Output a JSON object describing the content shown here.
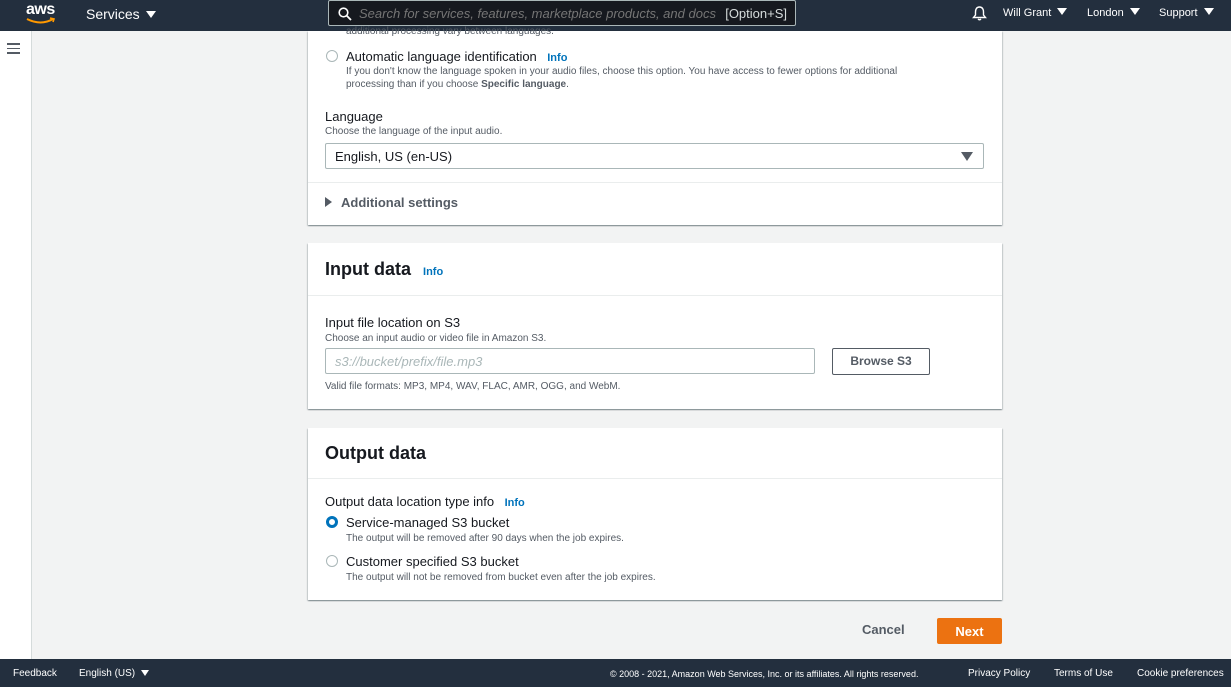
{
  "topnav": {
    "logo": "aws",
    "services": "Services",
    "search_placeholder": "Search for services, features, marketplace products, and docs",
    "search_shortcut": "[Option+S]",
    "user": "Will Grant",
    "region": "London",
    "support": "Support"
  },
  "language_panel": {
    "cutoff_text": "additional processing vary between languages.",
    "auto_id_label": "Automatic language identification",
    "auto_id_info": "Info",
    "auto_id_desc_1": "If you don't know the language spoken in your audio files, choose this option. You have access to fewer options for additional",
    "auto_id_desc_2_pre": "processing than if you choose ",
    "auto_id_desc_2_bold": "Specific language",
    "auto_id_desc_2_post": ".",
    "language_label": "Language",
    "language_desc": "Choose the language of the input audio.",
    "language_value": "English, US (en-US)",
    "additional_settings": "Additional settings"
  },
  "input_panel": {
    "title": "Input data",
    "info": "Info",
    "field_label": "Input file location on S3",
    "field_desc": "Choose an input audio or video file in Amazon S3.",
    "placeholder": "s3://bucket/prefix/file.mp3",
    "browse": "Browse S3",
    "formats": "Valid file formats: MP3, MP4, WAV, FLAC, AMR, OGG, and WebM."
  },
  "output_panel": {
    "title": "Output data",
    "location_label": "Output data location type info",
    "info": "Info",
    "opt1_label": "Service-managed S3 bucket",
    "opt1_desc": "The output will be removed after 90 days when the job expires.",
    "opt2_label": "Customer specified S3 bucket",
    "opt2_desc": "The output will not be removed from bucket even after the job expires."
  },
  "actions": {
    "cancel": "Cancel",
    "next": "Next"
  },
  "footer": {
    "feedback": "Feedback",
    "language": "English (US)",
    "copyright": "© 2008 - 2021, Amazon Web Services, Inc. or its affiliates. All rights reserved.",
    "privacy": "Privacy Policy",
    "terms": "Terms of Use",
    "cookies": "Cookie preferences"
  },
  "colors": {
    "nav_bg": "#232f3e",
    "link": "#0073bb",
    "primary_button": "#ec7211",
    "page_bg": "#f2f3f3"
  }
}
